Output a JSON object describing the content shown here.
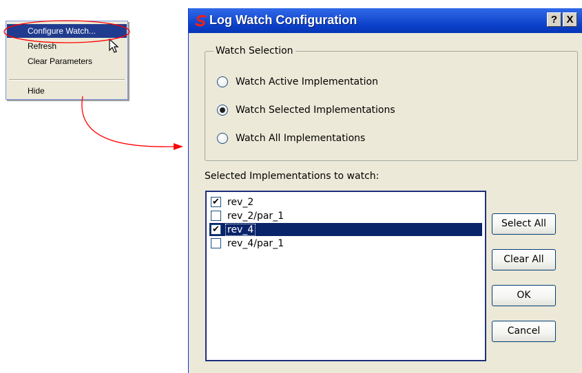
{
  "context_menu": {
    "items": [
      {
        "label": "Configure Watch..."
      },
      {
        "label": "Refresh"
      },
      {
        "label": "Clear Parameters"
      },
      {
        "label": "Hide"
      }
    ]
  },
  "dialog": {
    "title": "Log Watch Configuration",
    "help_button": "?",
    "close_button": "X",
    "watch_selection": {
      "title": "Watch Selection",
      "options": [
        {
          "label": "Watch Active Implementation",
          "checked": false
        },
        {
          "label": "Watch Selected Implementations",
          "checked": true
        },
        {
          "label": "Watch All Implementations",
          "checked": false
        }
      ]
    },
    "list_label": "Selected Implementations to watch:",
    "implementations": [
      {
        "name": "rev_2",
        "checked": true,
        "selected": false
      },
      {
        "name": "rev_2/par_1",
        "checked": false,
        "selected": false
      },
      {
        "name": "rev_4",
        "checked": true,
        "selected": true
      },
      {
        "name": "rev_4/par_1",
        "checked": false,
        "selected": false
      }
    ],
    "buttons": {
      "select_all": "Select All",
      "clear_all": "Clear All",
      "ok": "OK",
      "cancel": "Cancel"
    }
  },
  "colors": {
    "annotation": "#ff0000",
    "titlebar": "#0a3fc9",
    "selection": "#0a246a",
    "face": "#ece9d8"
  }
}
